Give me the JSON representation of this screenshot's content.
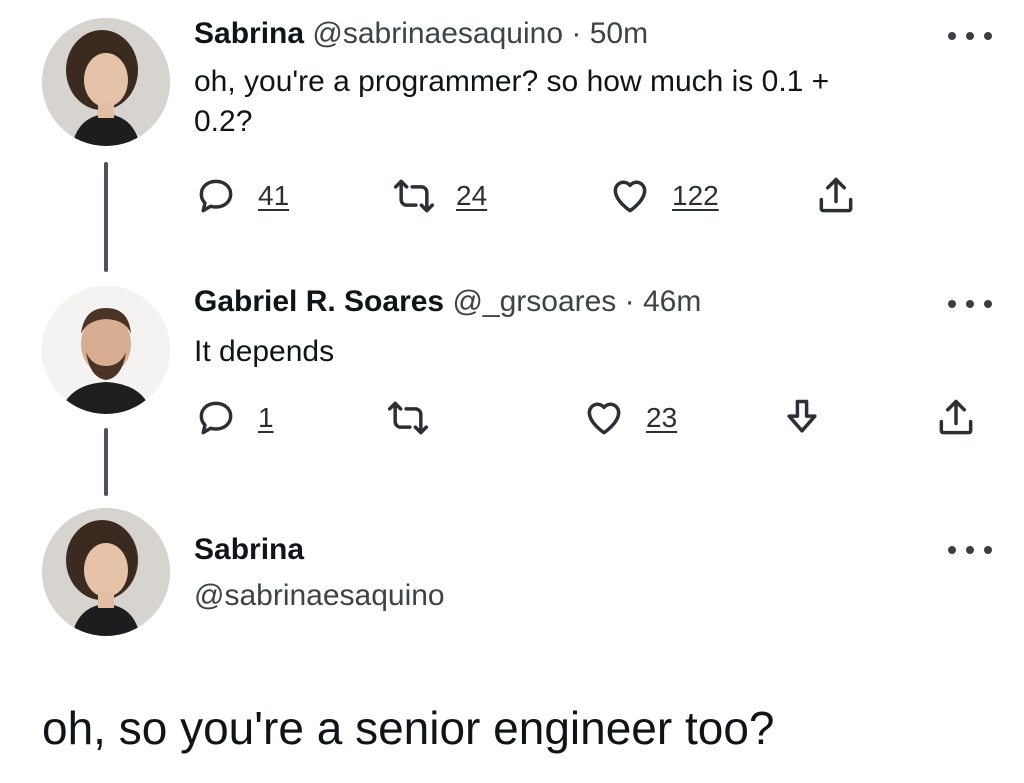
{
  "tweets": [
    {
      "name": "Sabrina",
      "handle": "@sabrinaesaquino",
      "separator": "·",
      "time": "50m",
      "text_line1": "oh, you're a programmer? so how much is 0.1 +",
      "text_line2": "0.2?",
      "replies": "41",
      "retweets": "24",
      "likes": "122"
    },
    {
      "name": "Gabriel R. Soares",
      "handle": "@_grsoares",
      "separator": "·",
      "time": "46m",
      "text": "It depends",
      "replies": "1",
      "likes": "23"
    }
  ],
  "quoted_profile": {
    "name": "Sabrina",
    "handle": "@sabrinaesaquino"
  },
  "caption": "oh, so you're a senior engineer too?",
  "icons": [
    "more-icon",
    "reply-icon",
    "retweet-icon",
    "like-icon",
    "share-icon",
    "download-icon"
  ],
  "colors": {
    "text": "#0f1419",
    "secondary": "#3d4348",
    "thread_line": "#4d5358"
  }
}
